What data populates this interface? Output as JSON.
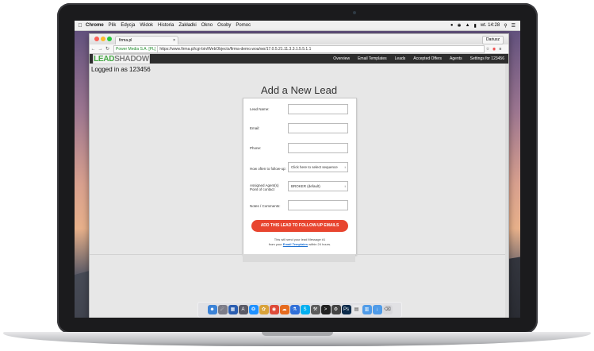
{
  "menubar": {
    "app": "Chrome",
    "items": [
      "Plik",
      "Edycja",
      "Widok",
      "Historia",
      "Zakładki",
      "Okno",
      "Osoby",
      "Pomoc"
    ],
    "clock": "wt. 14:28"
  },
  "browser": {
    "tab_title": "firma.pl",
    "user_button": "Dariusz",
    "secure_label": "Power Media S.A. [PL]",
    "url_host": "https://www.firma.pl",
    "url_path": "/cgi-bin/WebObjects/firma-demo.woa/wo/17.0.5.21.11.3.3.1.5.5.1.1"
  },
  "app": {
    "logo_lead": "LEAD",
    "logo_shadow": "SHADOW",
    "nav": [
      "Overview",
      "Email Templates",
      "Leads",
      "Accepted Offers",
      "Agents",
      "Settings for 123456"
    ],
    "logged_in": "Logged in as 123456",
    "heading": "Add a New Lead"
  },
  "form": {
    "lead_name_label": "Lead Name:",
    "email_label": "Email:",
    "phone_label": "Phone:",
    "followup_label": "How often to follow-up:",
    "followup_value": "Click here to select sequence",
    "agent_label_1": "Assigned Agent(s)",
    "agent_label_2": "Point of contact",
    "agent_value": "BROKER (default)",
    "notes_label": "Notes / Comments:",
    "submit_label": "ADD THIS LEAD TO FOLLOW-UP EMAILS",
    "note_line1": "This will send your lead Message #1",
    "note_line2_prefix": "from your",
    "note_link": "Email Templates",
    "note_line2_suffix": "within 24 hours."
  }
}
